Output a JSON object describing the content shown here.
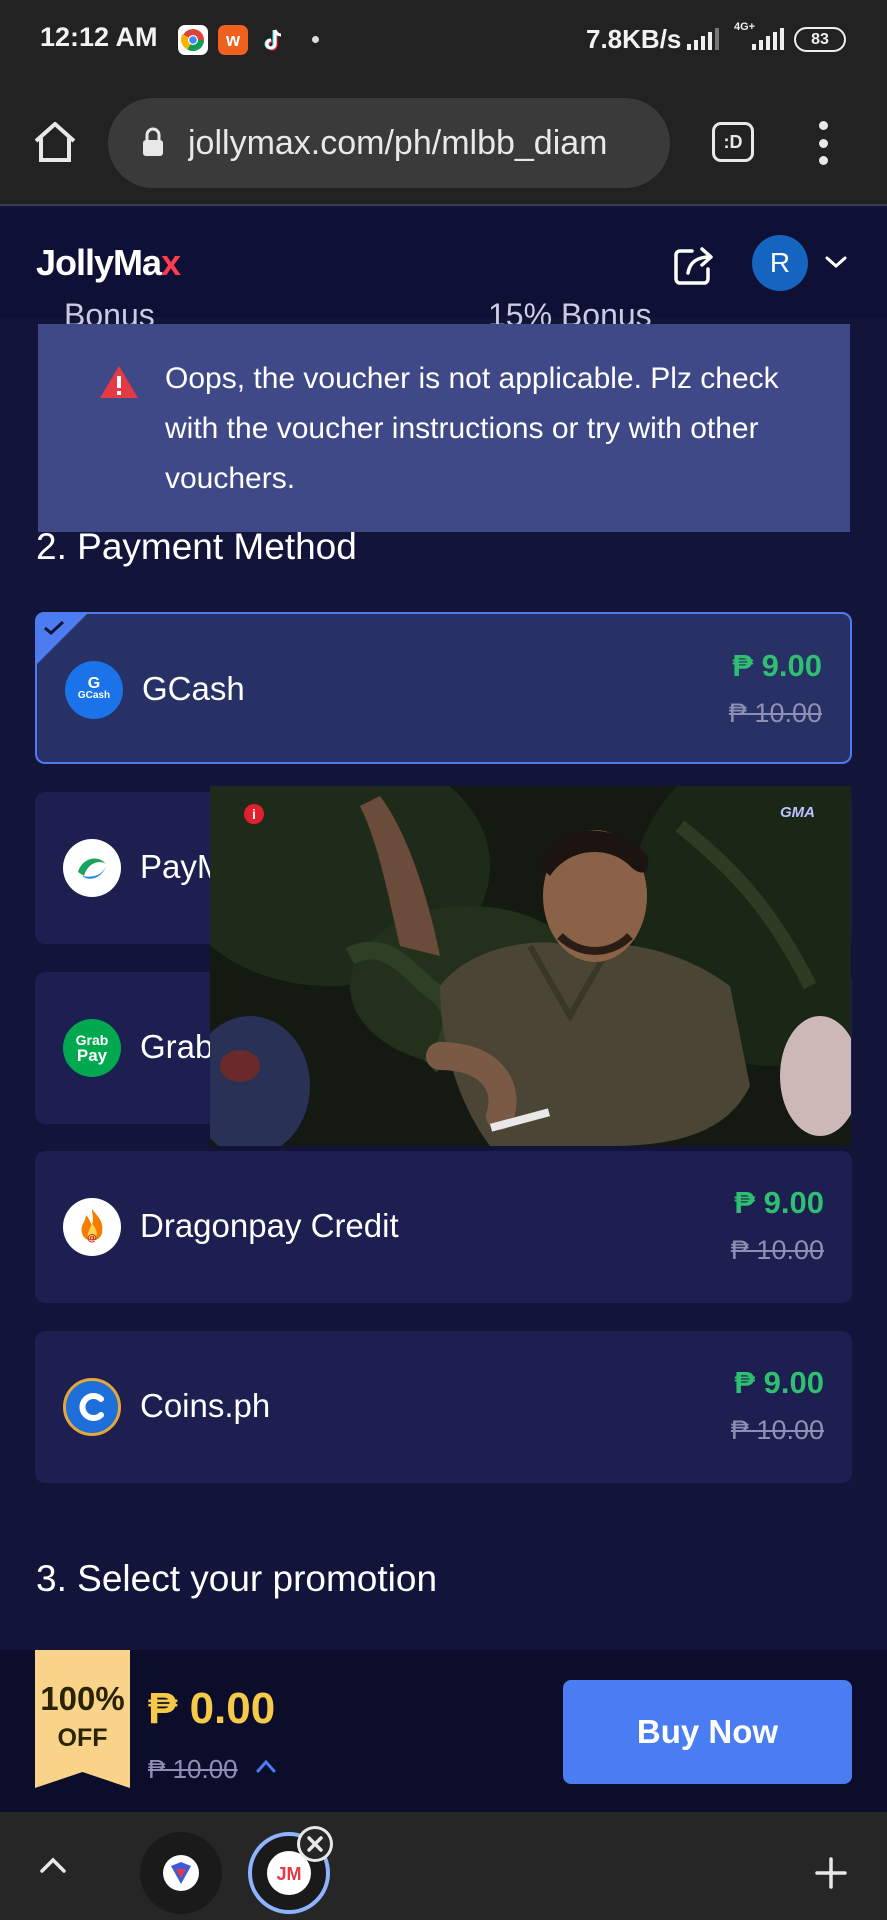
{
  "status_bar": {
    "time": "12:12 AM",
    "speed": "7.8KB/s",
    "network": "4G+",
    "battery": "83",
    "apps": [
      "chrome-icon",
      "w-app-icon",
      "tiktok-icon"
    ]
  },
  "browser": {
    "url": "jollymax.com/ph/mlbb_diam",
    "tabs_label": ":D"
  },
  "header": {
    "logo_main": "JollyMa",
    "logo_x": "x",
    "avatar_letter": "R"
  },
  "peek": {
    "left": "Bonus",
    "right": "15% Bonus"
  },
  "toast": {
    "message": "Oops, the voucher is not applicable. Plz check with the voucher instructions or try with other vouchers."
  },
  "payment": {
    "title": "2. Payment Method",
    "methods": [
      {
        "name": "GCash",
        "price": "₱ 9.00",
        "old_price": "₱ 10.00",
        "selected": true
      },
      {
        "name": "PayMaya",
        "price": "",
        "old_price": "",
        "selected": false
      },
      {
        "name": "GrabPay",
        "price": "",
        "old_price": "",
        "selected": false
      },
      {
        "name": "Dragonpay Credit",
        "price": "₱ 9.00",
        "old_price": "₱ 10.00",
        "selected": false
      },
      {
        "name": "Coins.ph",
        "price": "₱ 9.00",
        "old_price": "₱ 10.00",
        "selected": false
      }
    ]
  },
  "promotion": {
    "title": "3. Select your promotion"
  },
  "video": {
    "channel": "GMA",
    "info": "i"
  },
  "buy_bar": {
    "badge_pct": "100%",
    "badge_off": "OFF",
    "total": "₱ 0.00",
    "old_total": "₱ 10.00",
    "button": "Buy Now"
  },
  "tab_strip": {
    "tab2_label": "JM"
  },
  "colors": {
    "page_bg": "#12143a",
    "card_bg": "#1c1f4f",
    "accent_blue": "#4a7cf2",
    "price_green": "#2fbf71",
    "total_gold": "#f7c948",
    "toast_bg": "#3f4987",
    "warning_red": "#e53944"
  }
}
